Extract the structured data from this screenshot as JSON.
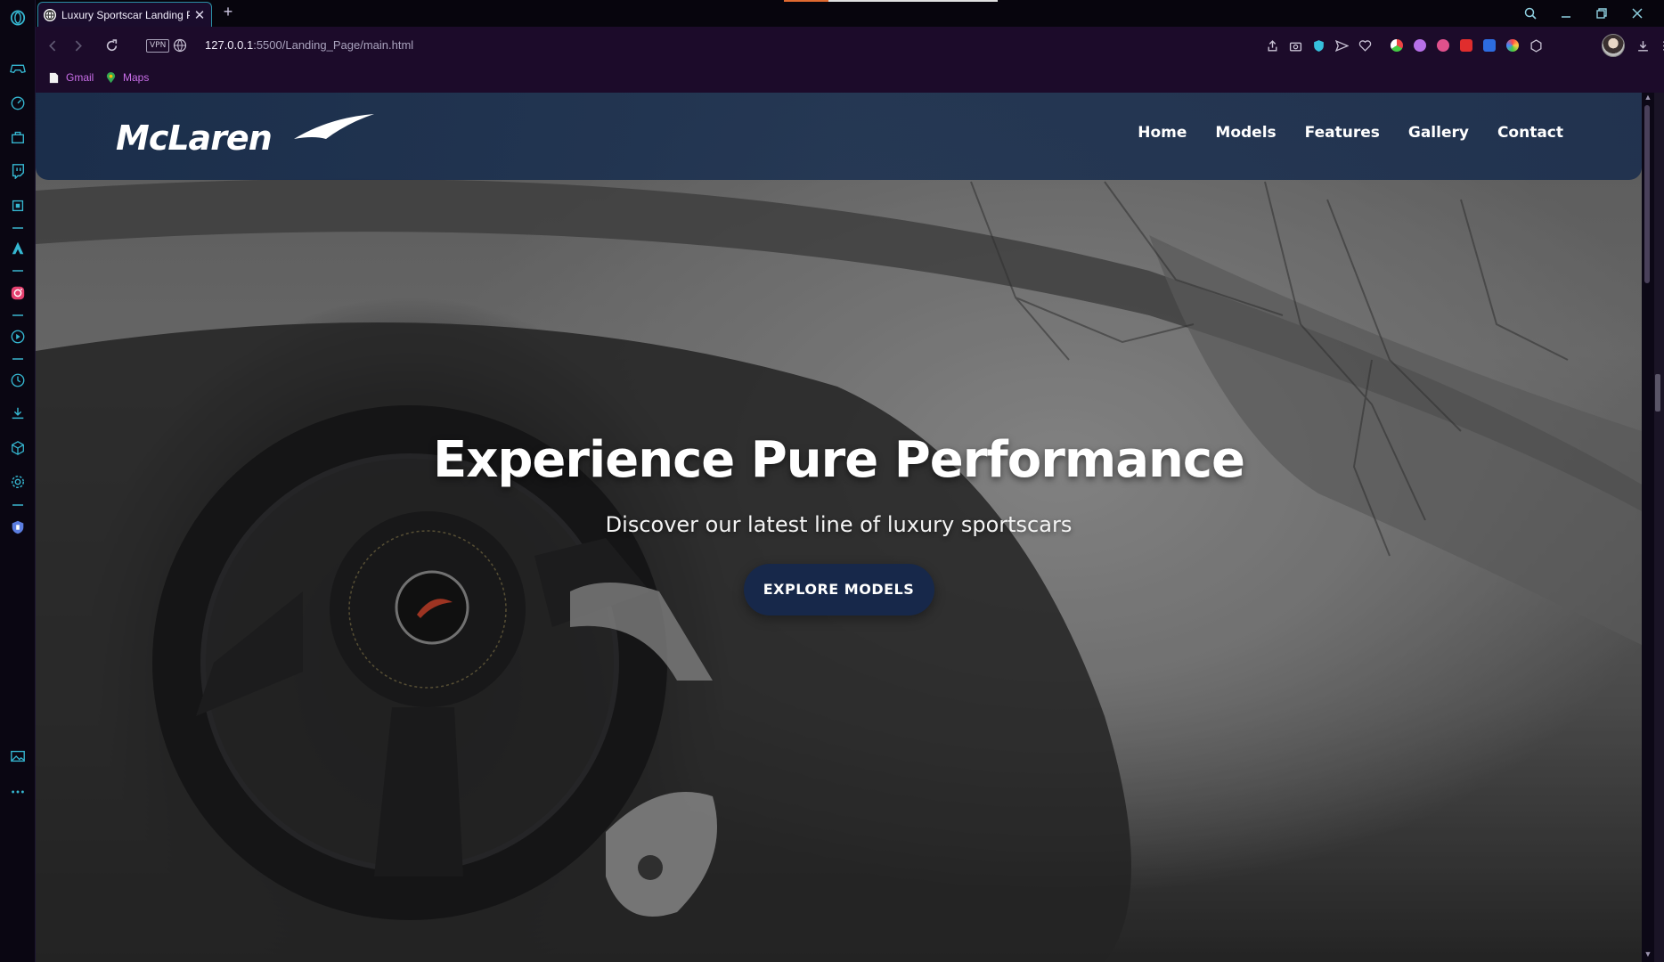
{
  "browser": {
    "tab": {
      "title": "Luxury Sportscar Landing P",
      "favicon": "globe-favicon"
    },
    "url": {
      "host": "127.0.0.1",
      "path": ":5500/Landing_Page/main.html"
    },
    "vpn_label": "VPN",
    "bookmarks": [
      {
        "label": "Gmail",
        "icon": "page-icon"
      },
      {
        "label": "Maps",
        "icon": "maps-pin-icon"
      }
    ],
    "accent_color": "#2a8ea4"
  },
  "site": {
    "brand": "McLaren",
    "nav": [
      "Home",
      "Models",
      "Features",
      "Gallery",
      "Contact"
    ],
    "hero": {
      "title": "Experience Pure Performance",
      "subtitle": "Discover our latest line of luxury sportscars",
      "cta": "EXPLORE MODELS"
    },
    "colors": {
      "navbar": "#1e3458",
      "cta_bg": "#17284a",
      "text": "#ffffff"
    }
  }
}
